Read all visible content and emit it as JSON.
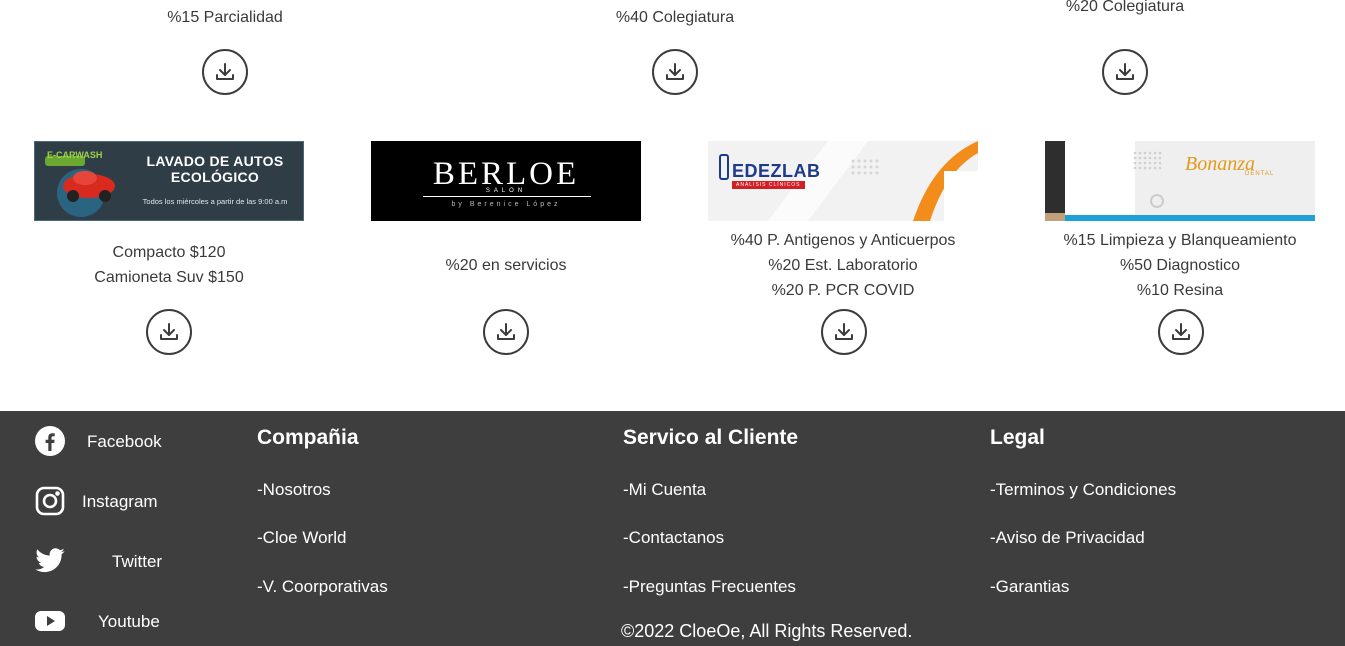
{
  "top_row": [
    {
      "lines": [
        "%15 Parcialidad"
      ]
    },
    {
      "lines": [
        "%40 Colegiatura"
      ]
    },
    {
      "lines": [
        "%20 Colegiatura"
      ]
    }
  ],
  "cards": [
    {
      "banner": {
        "title": "LAVADO DE AUTOS ECOLÓGICO",
        "subtitle": "Todos los miércoles a partir de las 9:00 a.m",
        "brand": "E-CARWASH"
      },
      "lines": [
        "Compacto $120",
        "Camioneta Suv $150"
      ]
    },
    {
      "banner": {
        "title": "BERLOE",
        "subtitle": "SALON",
        "byline": "by Berenice López"
      },
      "lines": [
        "%20 en servicios"
      ]
    },
    {
      "banner": {
        "title": "EDEZLAB",
        "subtitle": "ANÁLISIS CLÍNICOS"
      },
      "lines": [
        "%40 P. Antigenos y Anticuerpos",
        "%20 Est. Laboratorio",
        "%20 P. PCR COVID"
      ]
    },
    {
      "banner": {
        "title": "Bonanza",
        "subtitle": "DENTAL"
      },
      "lines": [
        "%15 Limpieza y Blanqueamiento",
        "%50 Diagnostico",
        "%10 Resina"
      ]
    }
  ],
  "footer": {
    "social": [
      {
        "label": "Facebook",
        "icon": "facebook-icon"
      },
      {
        "label": "Instagram",
        "icon": "instagram-icon"
      },
      {
        "label": "Twitter",
        "icon": "twitter-icon"
      },
      {
        "label": "Youtube",
        "icon": "youtube-icon"
      }
    ],
    "columns": [
      {
        "title": "Compañia",
        "links": [
          "-Nosotros",
          "-Cloe World",
          "-V. Coorporativas"
        ]
      },
      {
        "title": "Servico al Cliente",
        "links": [
          "-Mi Cuenta",
          "-Contactanos",
          "-Preguntas Frecuentes"
        ]
      },
      {
        "title": "Legal",
        "links": [
          "-Terminos y Condiciones",
          "-Aviso de Privacidad",
          "-Garantias"
        ]
      }
    ],
    "copyright": "©2022 CloeOe, All Rights Reserved."
  },
  "colors": {
    "footer_bg": "#3e3e3e",
    "text": "#3a3a3a",
    "edezlab_blue": "#1e3a8a",
    "bonanza_gold": "#e39a1b",
    "accent_orange": "#f28c1a",
    "accent_blue": "#1ea0d8"
  }
}
